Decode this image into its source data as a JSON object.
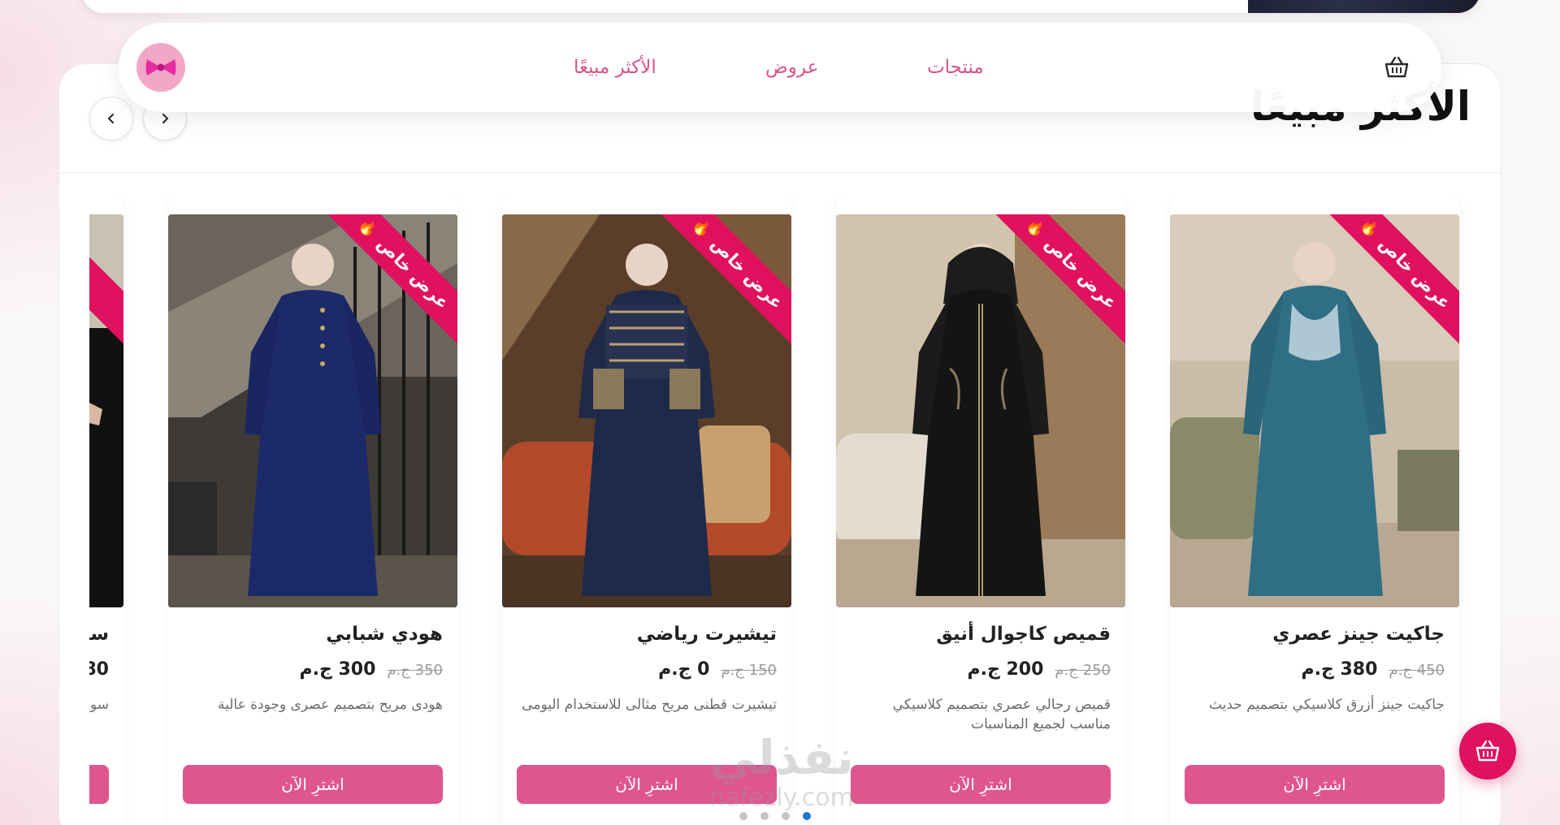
{
  "section": {
    "title": "الأكثر مبيعًا"
  },
  "nav": {
    "links": [
      "منتجات",
      "عروض",
      "الأكثر مبيعًا"
    ],
    "cart_icon": "basket-icon",
    "logo_icon": "bow-icon"
  },
  "carousel": {
    "prev_icon": "chevron-left-icon",
    "next_icon": "chevron-right-icon",
    "dots_count": 4,
    "active_dot": 3
  },
  "products": [
    {
      "badge": "عرض خاص",
      "name": "جاكيت جينز عصري",
      "price": "380 ج.م",
      "old_price": "450 ج.م",
      "description": "جاكيت جينز أزرق كلاسيكي بتصميم حديث",
      "button": "اشترِ الآن"
    },
    {
      "badge": "عرض خاص",
      "name": "قميص كاجوال أنيق",
      "price": "200 ج.م",
      "old_price": "250 ج.م",
      "description": "قميص رجالي عصري بتصميم كلاسيكي مناسب لجميع المناسبات",
      "button": "اشترِ الآن"
    },
    {
      "badge": "عرض خاص",
      "name": "تيشيرت رياضي",
      "price": "0 ج.م",
      "old_price": "150 ج.م",
      "description": "تيشيرت قطنى مريح مثالى للاستخدام اليومى",
      "button": "اشترِ الآن"
    },
    {
      "badge": "عرض خاص",
      "name": "هودي شبابي",
      "price": "300 ج.م",
      "old_price": "350 ج.م",
      "description": "هودى مريح بتصميم عصرى وجودة عالية",
      "button": "اشترِ الآن"
    },
    {
      "badge": "",
      "name": "سـ",
      "price": "80",
      "old_price": "",
      "description": "سو",
      "button": ""
    }
  ],
  "watermark": {
    "main": "نفذلي",
    "sub": "nafezly.com"
  },
  "colors": {
    "accent": "#df5590",
    "ribbon": "#e0115f",
    "nav_link": "#d9548d",
    "active_dot": "#1e73d6"
  }
}
